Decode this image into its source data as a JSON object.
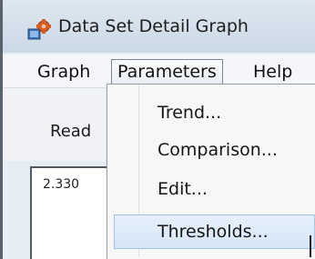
{
  "window": {
    "title": "Data Set Detail Graph",
    "icon": "app-gear-icon"
  },
  "menubar": {
    "items": [
      {
        "label": "Graph"
      },
      {
        "label": "Parameters",
        "active": true
      },
      {
        "label": "Help"
      }
    ]
  },
  "toolbar": {
    "read_label": "Read"
  },
  "graph": {
    "y_value": "2.330"
  },
  "dropdown": {
    "items": [
      {
        "label": "Trend..."
      },
      {
        "label": "Comparison..."
      },
      {
        "label": "Edit..."
      },
      {
        "label": "Thresholds...",
        "highlighted": true
      }
    ]
  },
  "colors": {
    "menu_highlight": "#d5e5f6",
    "menu_border": "#9fc2e8",
    "titlebar": "#cbd8e6"
  }
}
